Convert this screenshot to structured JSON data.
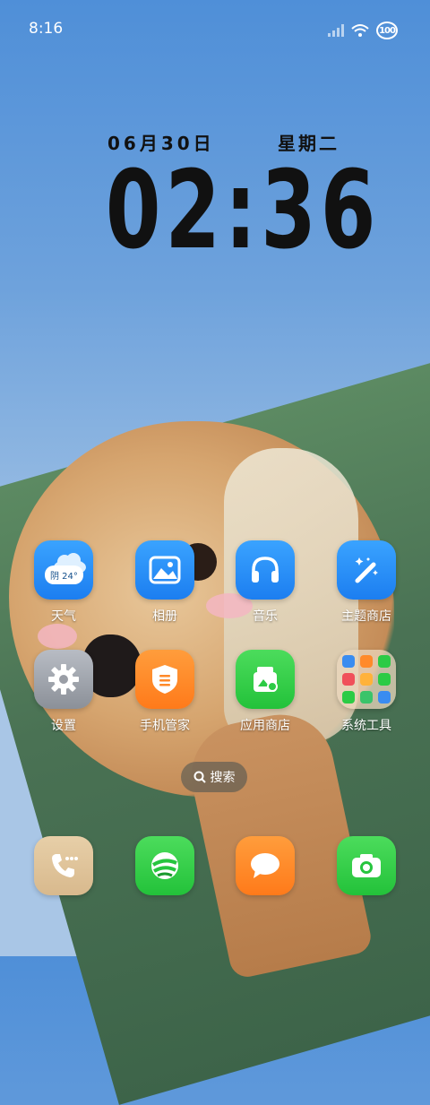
{
  "status_bar": {
    "time": "8:16",
    "battery_level": "100"
  },
  "clock_widget": {
    "date": "06月30日",
    "weekday": "星期二",
    "time": "02:36"
  },
  "apps": [
    {
      "label": "天气",
      "icon": "weather-icon",
      "badge": "阴 24°"
    },
    {
      "label": "相册",
      "icon": "gallery-icon"
    },
    {
      "label": "音乐",
      "icon": "headphones-icon"
    },
    {
      "label": "主题商店",
      "icon": "magic-wand-icon"
    },
    {
      "label": "设置",
      "icon": "gear-icon"
    },
    {
      "label": "手机管家",
      "icon": "shield-icon"
    },
    {
      "label": "应用商店",
      "icon": "app-store-icon"
    },
    {
      "label": "系统工具",
      "icon": "folder-icon"
    }
  ],
  "search": {
    "label": "搜索"
  },
  "dock": [
    {
      "icon": "phone-icon"
    },
    {
      "icon": "browser-icon"
    },
    {
      "icon": "message-icon"
    },
    {
      "icon": "camera-icon"
    }
  ],
  "colors": {
    "blue_tile": "#1c7ef0",
    "orange_tile": "#ff7a1a",
    "green_tile": "#23c23a"
  }
}
